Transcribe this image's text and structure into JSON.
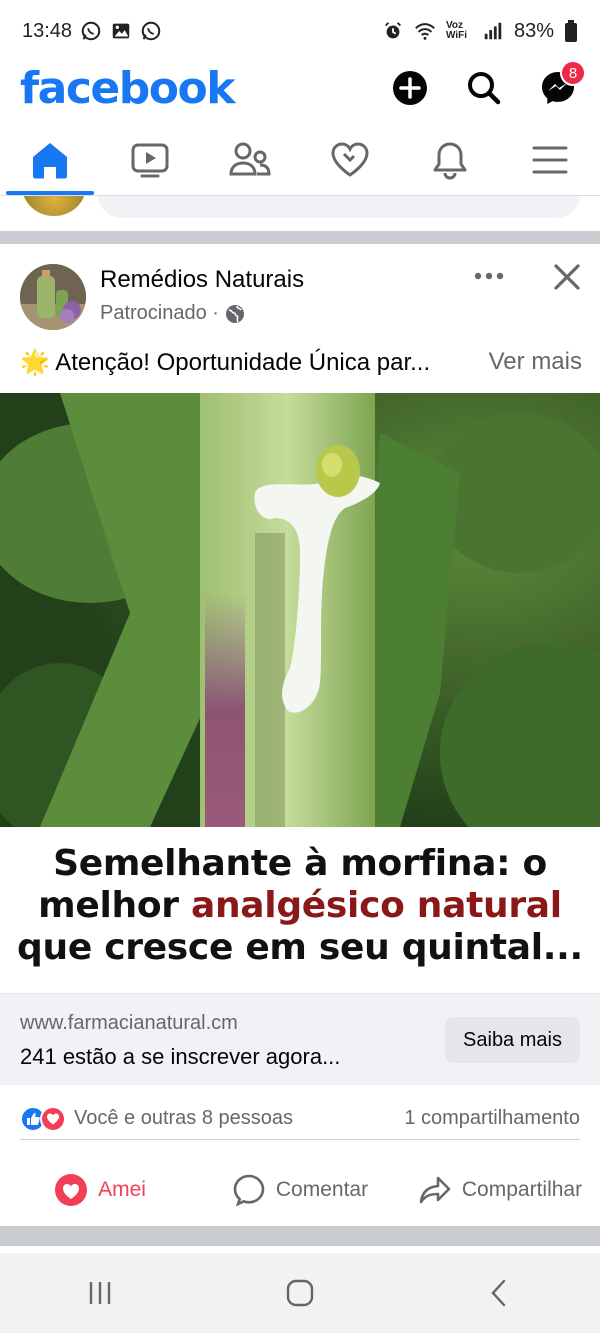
{
  "status_bar": {
    "time": "13:48",
    "network_label": "Voz WiFi",
    "battery": "83%"
  },
  "app": {
    "logo": "facebook",
    "messenger_badge": "8"
  },
  "tabs": [
    {
      "name": "home",
      "icon": "home-icon",
      "active": true
    },
    {
      "name": "watch",
      "icon": "video-icon",
      "active": false
    },
    {
      "name": "friends",
      "icon": "friends-icon",
      "active": false
    },
    {
      "name": "dating",
      "icon": "heart-icon",
      "active": false
    },
    {
      "name": "notifications",
      "icon": "bell-icon",
      "active": false
    },
    {
      "name": "menu",
      "icon": "menu-icon",
      "active": false
    }
  ],
  "post": {
    "author": "Remédios Naturais",
    "meta": "Patrocinado ·",
    "text": "🌟 Atenção! Oportunidade Única par...",
    "see_more": "Ver mais",
    "headline_line1": "Semelhante à morfina: o",
    "headline_line2_prefix": "melhor ",
    "headline_line2_accent": "analgésico natural",
    "headline_line3": "que cresce em seu quintal...",
    "link_url": "www.farmacianatural.cm",
    "link_description": "241 estão a se inscrever agora...",
    "cta_label": "Saiba mais",
    "reactions_text": "Você e outras 8 pessoas",
    "shares_text": "1 compartilhamento",
    "actions": {
      "love": "Amei",
      "comment": "Comentar",
      "share": "Compartilhar"
    }
  },
  "colors": {
    "brand": "#1877F2",
    "love": "#F33E58",
    "headline_accent": "#8B1818"
  }
}
